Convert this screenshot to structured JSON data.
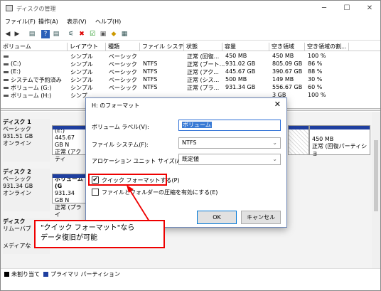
{
  "window": {
    "title": "ディスクの管理",
    "minimize": "─",
    "maximize": "☐",
    "close": "✕"
  },
  "menu": [
    "ファイル(F)",
    "操作(A)",
    "表示(V)",
    "ヘルプ(H)"
  ],
  "toolbar": [
    "◀",
    "▶",
    "▤",
    "?",
    "▤",
    "⚟",
    "✖",
    "☑",
    "▣",
    "◆",
    "▦"
  ],
  "volume_table": {
    "headers": [
      "ボリューム",
      "レイアウト",
      "種類",
      "ファイル システム",
      "状態",
      "容量",
      "空き領域",
      "空き領域の割..."
    ],
    "rows": [
      [
        "",
        "シンプル",
        "ベーシック",
        "",
        "正常 (回復...",
        "450 MB",
        "450 MB",
        "100 %"
      ],
      [
        "(C:)",
        "シンプル",
        "ベーシック",
        "NTFS",
        "正常 (ブート...",
        "931.02 GB",
        "805.09 GB",
        "86 %"
      ],
      [
        "(E:)",
        "シンプル",
        "ベーシック",
        "NTFS",
        "正常 (アク...",
        "445.67 GB",
        "390.67 GB",
        "88 %"
      ],
      [
        "システムで予約済み",
        "シンプル",
        "ベーシック",
        "NTFS",
        "正常 (シス...",
        "500 MB",
        "149 MB",
        "30 %"
      ],
      [
        "ボリューム (G:)",
        "シンプル",
        "ベーシック",
        "NTFS",
        "正常 (プラ...",
        "931.34 GB",
        "556.67 GB",
        "60 %"
      ],
      [
        "ボリューム (H:)",
        "シンプ",
        "",
        "",
        "",
        "",
        "3 GB",
        "100 %"
      ]
    ]
  },
  "disks": [
    {
      "name": "ディスク 1",
      "type": "ベーシック",
      "size": "931.51 GB",
      "status": "オンライン",
      "part1": {
        "name": "(E:)",
        "size": "445.67 GB N",
        "status": "正常 (アクティ"
      },
      "part2": {
        "size": "450 MB",
        "status": "正常 (回復パーティショ"
      }
    },
    {
      "name": "ディスク 2",
      "type": "ベーシック",
      "size": "931.34 GB",
      "status": "オンライン",
      "part1": {
        "name": "ボリューム (G",
        "size": "931.34 GB N",
        "status": "正常 (プライ"
      }
    },
    {
      "name": "ディスク",
      "type": "リムーバブ",
      "size": "",
      "status": "メディアな"
    }
  ],
  "legend": {
    "unallocated": "未割り当て",
    "primary": "プライマリ パーティション",
    "unalloc_color": "#000000",
    "primary_color": "#1f3f9f"
  },
  "dialog": {
    "title": "H: のフォーマット",
    "close": "✕",
    "volume_label_label": "ボリューム ラベル(V):",
    "volume_label_value": "ボリューム",
    "filesystem_label": "ファイル システム(F):",
    "filesystem_value": "NTFS",
    "alloc_label": "アロケーション ユニット サイズ(A):",
    "alloc_value": "既定値",
    "quick_format_label": "クイック フォーマットする(P)",
    "quick_format_checked": "✔",
    "compression_label": "ファイルとフォルダーの圧縮を有効にする(E)",
    "ok": "OK",
    "cancel": "キャンセル"
  },
  "callout": {
    "line1": "\"クイック フォーマット\"なら",
    "line2": "データ復旧が可能",
    "border_color": "#e00000"
  }
}
